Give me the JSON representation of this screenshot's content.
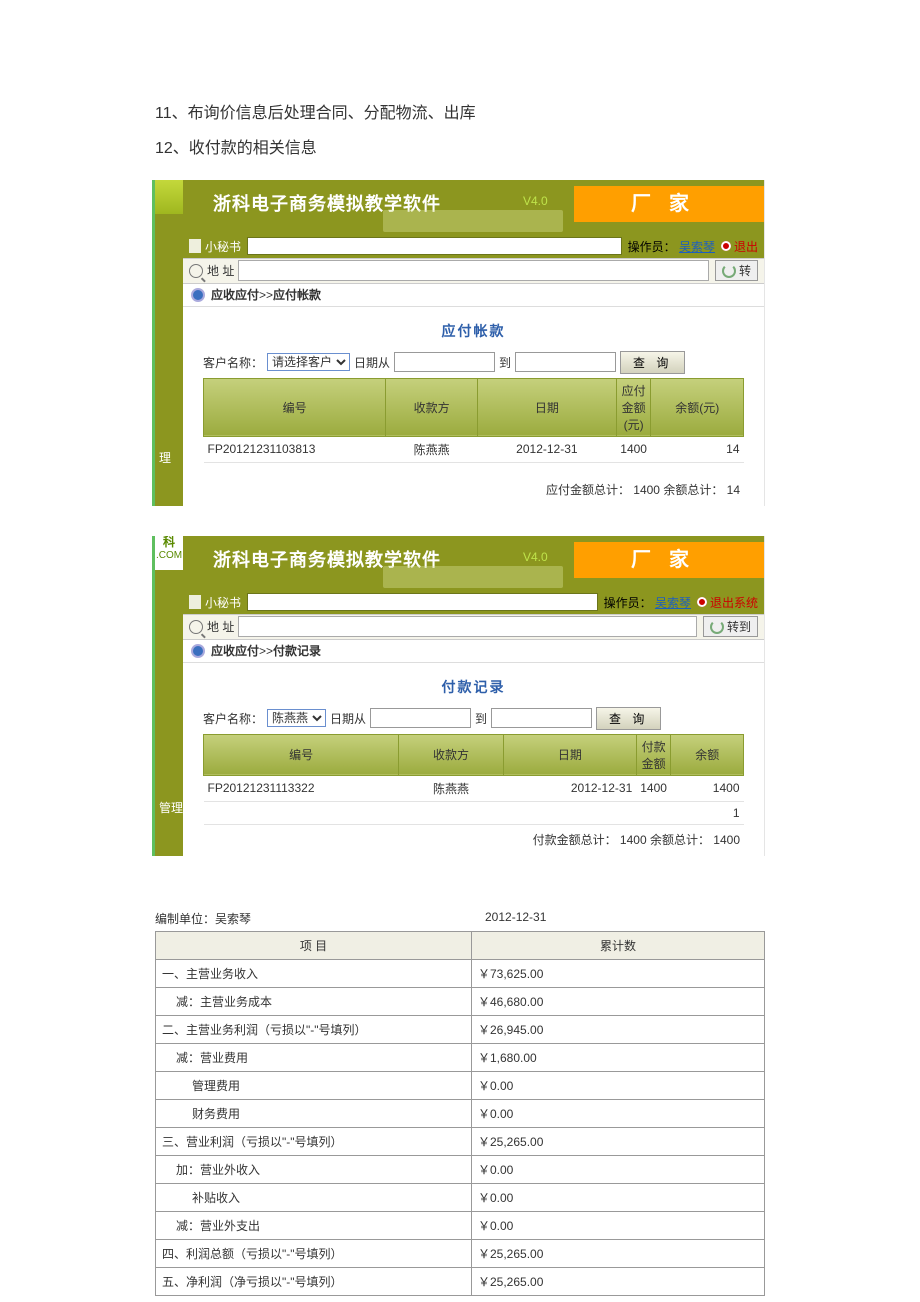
{
  "doc": {
    "line11": "11、布询价信息后处理合同、分配物流、出库",
    "line12": "12、收付款的相关信息"
  },
  "panel1": {
    "app_title": "浙科电子商务模拟教学软件",
    "version": "V4.0",
    "corner_label": "厂家",
    "secretary_label": "小秘书",
    "operator_label": "操作员：",
    "operator_name": "吴索琴",
    "exit_label": "退出",
    "addr_label": "地 址",
    "goto_label": "转",
    "breadcrumb_parent": "应收应付",
    "breadcrumb_sep": ">>",
    "breadcrumb_child": "应付帐款",
    "section_title": "应付帐款",
    "cust_label": "客户名称：",
    "cust_placeholder": "请选择客户",
    "date_from_label": "日期从",
    "date_to_label": "到",
    "query_label": "查 询",
    "side_tab": "理",
    "cols": [
      "编号",
      "收款方",
      "日期",
      "应付金额(元)",
      "余额(元)"
    ],
    "row": {
      "id": "FP20121231103813",
      "payee": "陈燕燕",
      "date": "2012-12-31",
      "amount": "1400",
      "balance": "14"
    },
    "total_text": "应付金额总计： 1400 余额总计： 14"
  },
  "panel2": {
    "logo_top": "科",
    "logo_bot": ".COM",
    "app_title": "浙科电子商务模拟教学软件",
    "version": "V4.0",
    "corner_label": "厂家",
    "secretary_label": "小秘书",
    "operator_label": "操作员：",
    "operator_name": "吴索琴",
    "exit_label": "退出系统",
    "addr_label": "地 址",
    "goto_label": "转到",
    "breadcrumb_parent": "应收应付",
    "breadcrumb_sep": ">>",
    "breadcrumb_child": "付款记录",
    "section_title": "付款记录",
    "cust_label": "客户名称：",
    "cust_value": "陈燕燕",
    "date_from_label": "日期从",
    "date_to_label": "到",
    "query_label": "查 询",
    "side_tab": "管理",
    "cols": [
      "编号",
      "收款方",
      "日期",
      "付款金额",
      "余额"
    ],
    "row": {
      "id": "FP20121231113322",
      "payee": "陈燕燕",
      "date": "2012-12-31",
      "amount": "1400",
      "balance": "1400"
    },
    "extra_row_balance": "1",
    "total_text": "付款金额总计： 1400 余额总计： 1400"
  },
  "acct": {
    "unit_label": "编制单位：",
    "unit_name": "吴索琴",
    "date": "2012-12-31",
    "col_item": "项 目",
    "col_amt": "累计数",
    "rows": [
      {
        "label": "一、主营业务收入",
        "amt": "￥73,625.00",
        "indent": 0
      },
      {
        "label": "减：主营业务成本",
        "amt": "￥46,680.00",
        "indent": 1
      },
      {
        "label": "二、主营业务利润（亏损以\"-\"号填列）",
        "amt": "￥26,945.00",
        "indent": 0
      },
      {
        "label": "减：营业费用",
        "amt": "￥1,680.00",
        "indent": 1
      },
      {
        "label": "管理费用",
        "amt": "￥0.00",
        "indent": 2
      },
      {
        "label": "财务费用",
        "amt": "￥0.00",
        "indent": 2
      },
      {
        "label": "三、营业利润（亏损以\"-\"号填列）",
        "amt": "￥25,265.00",
        "indent": 0
      },
      {
        "label": "加：营业外收入",
        "amt": "￥0.00",
        "indent": 1
      },
      {
        "label": "补贴收入",
        "amt": "￥0.00",
        "indent": 2
      },
      {
        "label": "减：营业外支出",
        "amt": "￥0.00",
        "indent": 1
      },
      {
        "label": "四、利润总额（亏损以\"-\"号填列）",
        "amt": "￥25,265.00",
        "indent": 0
      },
      {
        "label": "五、净利润（净亏损以\"-\"号填列）",
        "amt": "￥25,265.00",
        "indent": 0
      }
    ]
  }
}
